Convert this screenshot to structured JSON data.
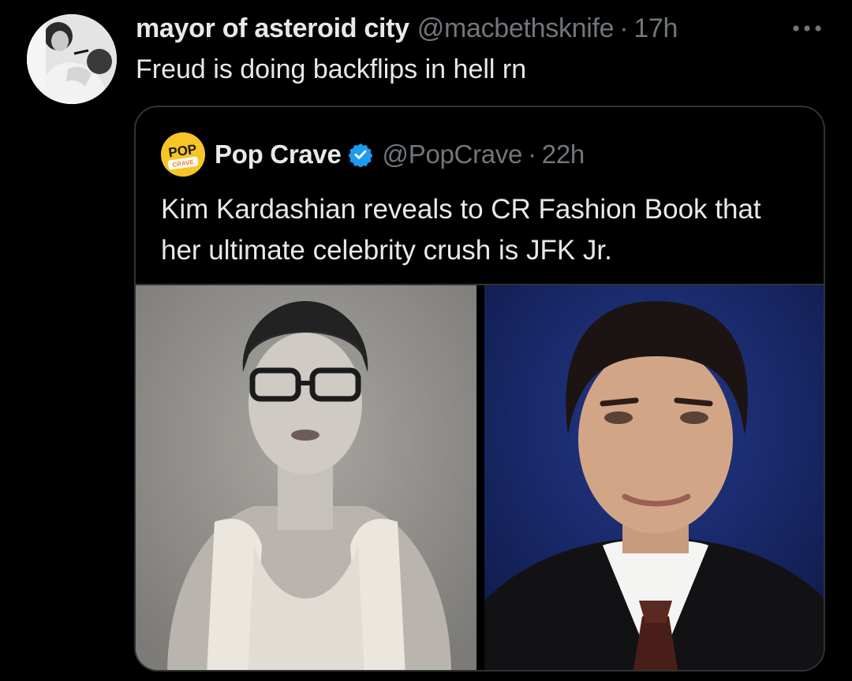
{
  "tweet": {
    "display_name": "mayor of asteroid city",
    "handle": "@macbethsknife",
    "separator": "·",
    "time": "17h",
    "text": "Freud is doing backflips in hell rn",
    "avatar_icon": "user-avatar-photo",
    "more_icon": "more-options-icon"
  },
  "quote": {
    "display_name": "Pop Crave",
    "handle": "@PopCrave",
    "separator": "·",
    "time": "22h",
    "verified": true,
    "verified_icon": "verified-badge-icon",
    "text": "Kim Kardashian reveals to CR Fashion Book that her ultimate celebrity crush is JFK Jr.",
    "avatar": {
      "logo_line1": "POP",
      "logo_line2": "CRAVE"
    },
    "media": [
      {
        "name": "media-photo-left",
        "icon": "woman-glasses-photo"
      },
      {
        "name": "media-photo-right",
        "icon": "man-suit-photo"
      }
    ]
  },
  "colors": {
    "background": "#000000",
    "text_primary": "#e7e9ea",
    "text_secondary": "#71767b",
    "border": "#2f3336",
    "verified_blue": "#1d9bf0",
    "pop_crave_yellow": "#f7c526",
    "pop_crave_orange": "#f47b20"
  }
}
